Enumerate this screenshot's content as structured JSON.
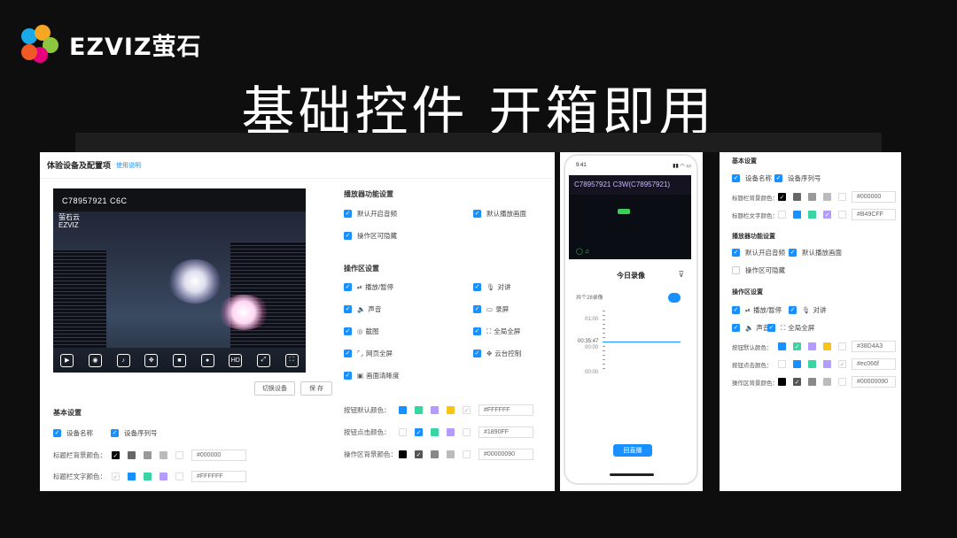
{
  "brand": {
    "name": "EZVIZ萤石"
  },
  "headline": "基础控件 开箱即用",
  "panel1": {
    "title": "体验设备及配置项",
    "link": "使用说明",
    "video_title": "C78957921 C6C",
    "video_logo_cn": "萤石云",
    "video_logo_en": "EZVIZ",
    "btn_switch": "切换设备",
    "btn_save": "保 存",
    "basic": {
      "title": "基本设置",
      "device_name": "设备名称",
      "device_serial": "设备序列号",
      "title_bg_label": "标题栏背景颜色：",
      "title_bg_hex": "#000000",
      "title_text_label": "标题栏文字颜色：",
      "title_text_hex": "#FFFFFF"
    },
    "player": {
      "title": "播放器功能设置",
      "auto_audio": "默认开启音频",
      "default_screen": "默认播放画面",
      "hide_ops": "操作区可隐藏"
    },
    "ops": {
      "title": "操作区设置",
      "play_pause": "播放/暂停",
      "talk": "对讲",
      "sound": "声音",
      "record": "录屏",
      "capture": "截图",
      "fullscreen": "全局全屏",
      "web_fullscreen": "网页全屏",
      "ptz": "云台控制",
      "hd": "画面清晰度",
      "btn_default_label": "按钮默认颜色：",
      "btn_default_hex": "#FFFFFF",
      "btn_click_label": "按钮点击颜色：",
      "btn_click_hex": "#1890FF",
      "ops_bg_label": "操作区背景颜色：",
      "ops_bg_hex": "#00000090"
    }
  },
  "phone": {
    "time": "9:41",
    "video_title": "C78957921 C3W(C78957921)",
    "record_title": "今日录像",
    "record_count": "共个28录像",
    "times": [
      "01:00",
      "00:35:47",
      "00:00",
      "00:00"
    ],
    "back_btn": "回直播"
  },
  "panel3": {
    "basic_title": "基本设置",
    "device_name": "设备名称",
    "device_serial": "设备序列号",
    "title_bg_label": "标题栏背景颜色：",
    "title_bg_hex": "#000000",
    "title_text_label": "标题栏文字颜色：",
    "title_text_hex": "#B49CFF",
    "player_title": "播放器功能设置",
    "auto_audio": "默认开启音频",
    "default_screen": "默认播放画面",
    "hide_ops": "操作区可隐藏",
    "ops_title": "操作区设置",
    "play_pause": "播放/暂停",
    "talk": "对讲",
    "sound": "声音",
    "fullscreen": "全局全屏",
    "btn_default_label": "按钮默认颜色：",
    "btn_default_hex": "#38D4A3",
    "btn_click_label": "按钮点击颜色：",
    "btn_click_hex": "#ec066f",
    "ops_bg_label": "操作区背景颜色：",
    "ops_bg_hex": "#00000090"
  },
  "colors": {
    "accent": "#1890ff",
    "bg": "#0e0e0e"
  }
}
